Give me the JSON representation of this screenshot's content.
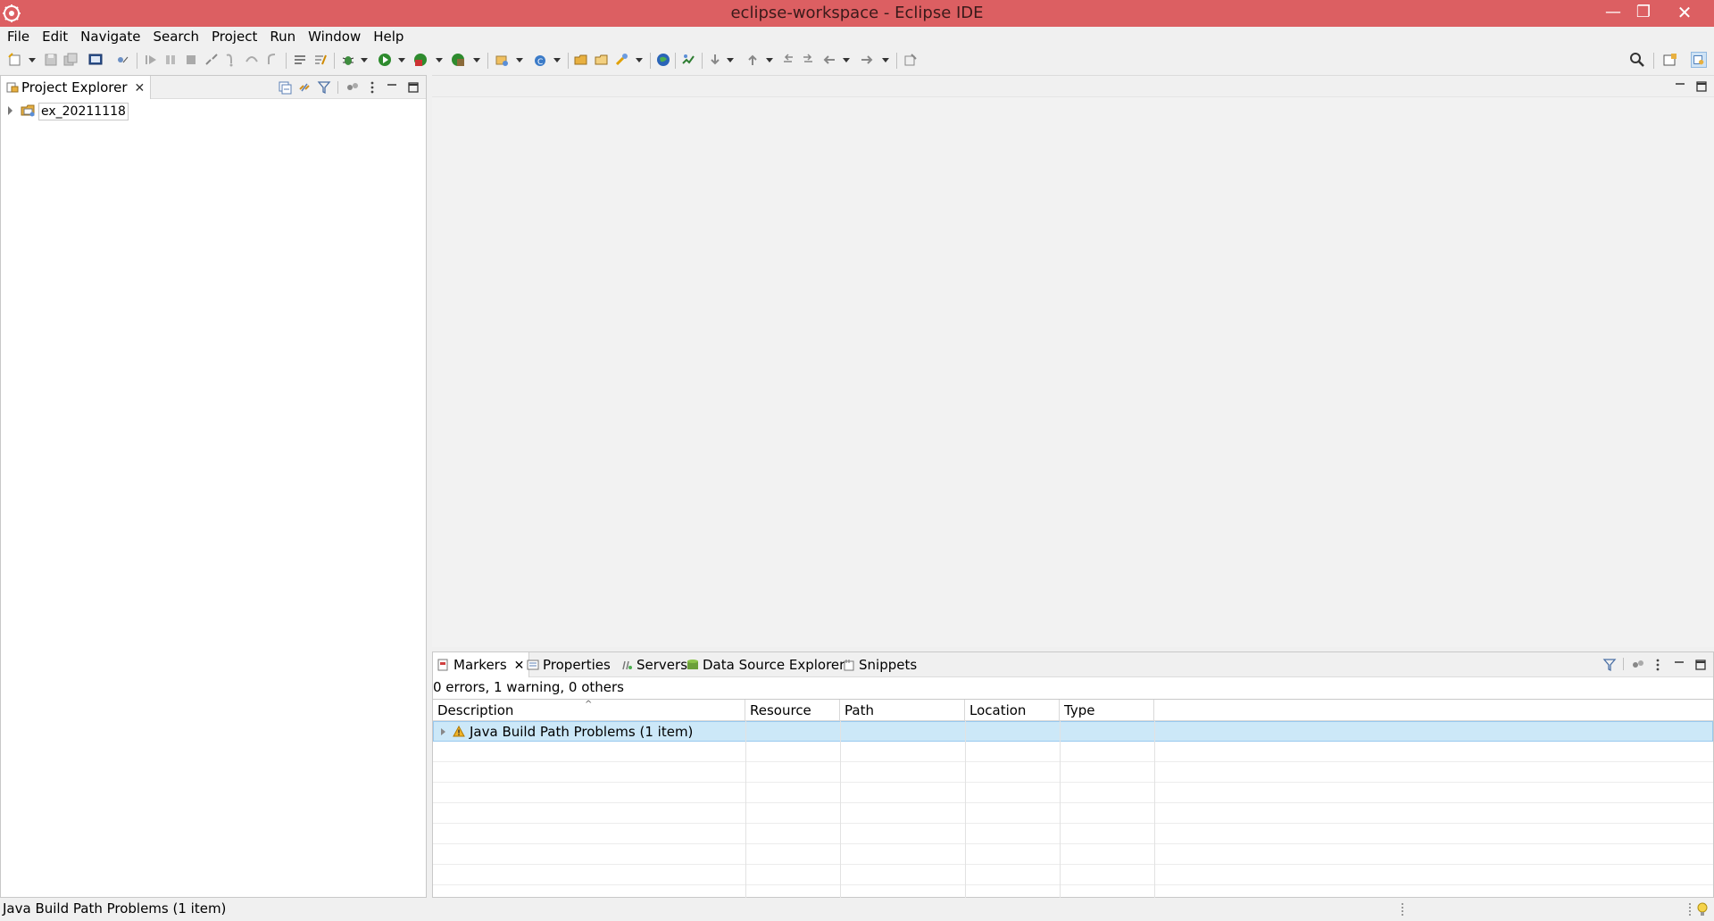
{
  "window": {
    "title": "eclipse-workspace - Eclipse IDE",
    "minimize_glyph": "—",
    "maximize_glyph": "❐",
    "close_glyph": "✕"
  },
  "menu": {
    "items": [
      "File",
      "Edit",
      "Navigate",
      "Search",
      "Project",
      "Run",
      "Window",
      "Help"
    ]
  },
  "project_explorer": {
    "tab_label": "Project Explorer",
    "close_glyph": "✕",
    "projects": [
      {
        "name": "ex_20211118",
        "expanded": false
      }
    ]
  },
  "bottom_panel": {
    "tabs": [
      {
        "label": "Markers",
        "active": true,
        "closable": true
      },
      {
        "label": "Properties",
        "active": false
      },
      {
        "label": "Servers",
        "active": false
      },
      {
        "label": "Data Source Explorer",
        "active": false
      },
      {
        "label": "Snippets",
        "active": false
      }
    ],
    "close_glyph": "✕",
    "summary": "0 errors, 1 warning, 0 others",
    "columns": [
      "Description",
      "Resource",
      "Path",
      "Location",
      "Type"
    ],
    "rows": [
      {
        "description": "Java Build Path Problems (1 item)",
        "severity": "warning",
        "selected": true
      }
    ]
  },
  "status_bar": {
    "text": "Java Build Path Problems (1 item)"
  },
  "colors": {
    "titlebar": "#dc5f62",
    "selection": "#cce8f8",
    "warning": "#e8a317"
  }
}
